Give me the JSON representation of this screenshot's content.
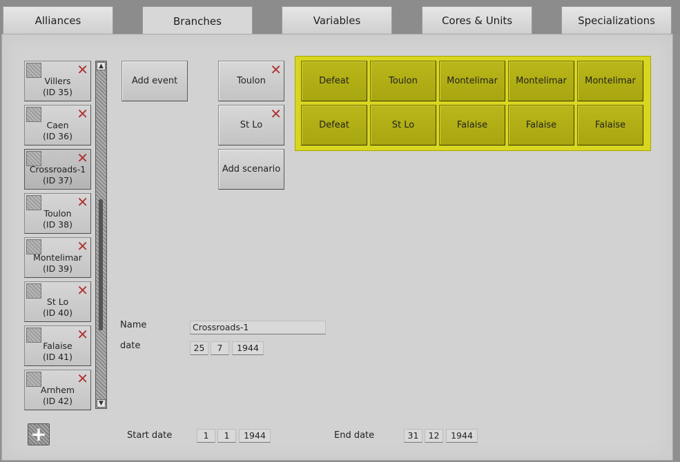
{
  "tabs": [
    {
      "label": "Alliances"
    },
    {
      "label": "Branches"
    },
    {
      "label": "Variables"
    },
    {
      "label": "Cores & Units"
    },
    {
      "label": "Specializations"
    }
  ],
  "event_list": [
    {
      "name": "Villers",
      "id": "(ID 35)"
    },
    {
      "name": "Caen",
      "id": "(ID 36)"
    },
    {
      "name": "Crossroads-1",
      "id": "(ID 37)"
    },
    {
      "name": "Toulon",
      "id": "(ID 38)"
    },
    {
      "name": "Montelimar",
      "id": "(ID 39)"
    },
    {
      "name": "St Lo",
      "id": "(ID 40)"
    },
    {
      "name": "Falaise",
      "id": "(ID 41)"
    },
    {
      "name": "Arnhem",
      "id": "(ID 42)"
    }
  ],
  "selected_event_index": 2,
  "add_event_label": "Add event",
  "scenarios": [
    {
      "label": "Toulon"
    },
    {
      "label": "St Lo"
    }
  ],
  "add_scenario_label": "Add scenario",
  "outcome_grid": [
    [
      "Defeat",
      "Toulon",
      "Montelimar",
      "Montelimar",
      "Montelimar"
    ],
    [
      "Defeat",
      "St Lo",
      "Falaise",
      "Falaise",
      "Falaise"
    ]
  ],
  "form": {
    "name_label": "Name",
    "name_value": "Crossroads-1",
    "date_label": "date",
    "date_day": "25",
    "date_month": "7",
    "date_year": "1944"
  },
  "footer": {
    "start_label": "Start date",
    "start_day": "1",
    "start_month": "1",
    "start_year": "1944",
    "end_label": "End date",
    "end_day": "31",
    "end_month": "12",
    "end_year": "1944"
  },
  "colors": {
    "outcome_panel": "#d8d620",
    "outcome_button": "#b0ae16",
    "delete_icon": "#b03535"
  },
  "icons": {
    "delete": "close-x-icon",
    "add": "plus-icon",
    "scroll_up": "arrow-up-icon",
    "scroll_down": "arrow-down-icon"
  }
}
